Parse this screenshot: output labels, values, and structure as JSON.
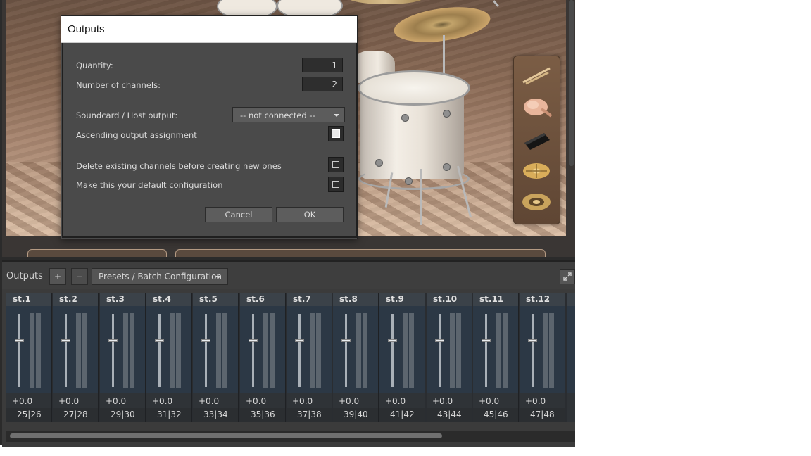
{
  "dialog": {
    "title": "Outputs",
    "quantity_label": "Quantity:",
    "quantity_value": "1",
    "channels_label": "Number of channels:",
    "channels_value": "2",
    "host_output_label": "Soundcard / Host output:",
    "host_output_value": "-- not connected --",
    "ascending_label": "Ascending output assignment",
    "ascending_checked": true,
    "delete_label": "Delete existing channels before creating new ones",
    "delete_checked": false,
    "default_label": "Make this your default configuration",
    "default_checked": false,
    "cancel_label": "Cancel",
    "ok_label": "OK"
  },
  "outputs": {
    "title": "Outputs",
    "add_label": "+",
    "remove_label": "−",
    "presets_label": "Presets / Batch Configuration",
    "channels": [
      {
        "name": "st.1",
        "volume": "+0.0",
        "routing": "25|26"
      },
      {
        "name": "st.2",
        "volume": "+0.0",
        "routing": "27|28"
      },
      {
        "name": "st.3",
        "volume": "+0.0",
        "routing": "29|30"
      },
      {
        "name": "st.4",
        "volume": "+0.0",
        "routing": "31|32"
      },
      {
        "name": "st.5",
        "volume": "+0.0",
        "routing": "33|34"
      },
      {
        "name": "st.6",
        "volume": "+0.0",
        "routing": "35|36"
      },
      {
        "name": "st.7",
        "volume": "+0.0",
        "routing": "37|38"
      },
      {
        "name": "st.8",
        "volume": "+0.0",
        "routing": "39|40"
      },
      {
        "name": "st.9",
        "volume": "+0.0",
        "routing": "41|42"
      },
      {
        "name": "st.10",
        "volume": "+0.0",
        "routing": "43|44"
      },
      {
        "name": "st.11",
        "volume": "+0.0",
        "routing": "45|46"
      },
      {
        "name": "st.12",
        "volume": "+0.0",
        "routing": "47|48"
      }
    ]
  },
  "palette": {
    "items": [
      "drumsticks-icon",
      "brush-icon",
      "cowbell-icon",
      "cymbal-stack-icon",
      "hihat-icon"
    ]
  },
  "colors": {
    "dialog_bg": "#4a4a4a",
    "panel_bg": "#3b3b3b",
    "strip_fader_bg": "#2c3845",
    "strip_header_bg": "#3b4249"
  }
}
